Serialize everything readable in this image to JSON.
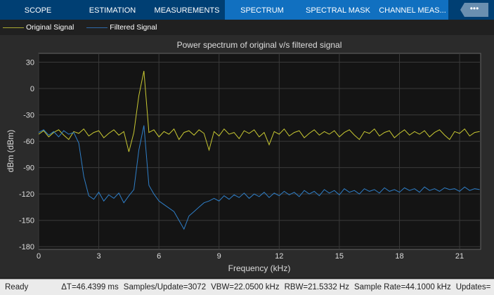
{
  "tabs": [
    {
      "label": "SCOPE",
      "active": false
    },
    {
      "label": "ESTIMATION",
      "active": false
    },
    {
      "label": "MEASUREMENTS",
      "active": false
    },
    {
      "label": "SPECTRUM",
      "active": true
    },
    {
      "label": "SPECTRAL MASK",
      "active": true
    },
    {
      "label": "CHANNEL MEAS..."
    }
  ],
  "more_label": "•••",
  "legend": [
    {
      "label": "Original Signal",
      "color": "#c8c832"
    },
    {
      "label": "Filtered Signal",
      "color": "#2f7fc8"
    }
  ],
  "status": {
    "state": "Ready",
    "delta_t": "ΔT=46.4399 ms",
    "samples": "Samples/Update=3072",
    "vbw": "VBW=22.0500 kHz",
    "rbw": "RBW=21.5332 Hz",
    "rate": "Sample Rate=44.1000 kHz",
    "updates": "Updates="
  },
  "chart_data": {
    "type": "line",
    "title": "Power spectrum of original v/s filtered signal",
    "xlabel": "Frequency (kHz)",
    "ylabel": "dBm (dBm)",
    "xlim": [
      0,
      22.05
    ],
    "ylim": [
      -183,
      40
    ],
    "xticks": [
      0,
      3,
      6,
      9,
      12,
      15,
      18,
      21
    ],
    "yticks": [
      30,
      0,
      -30,
      -60,
      -90,
      -120,
      -150,
      -180
    ],
    "grid": true,
    "x_step": 0.25,
    "series": [
      {
        "name": "Original Signal",
        "color": "#c8c832",
        "values": [
          -52,
          -48,
          -55,
          -50,
          -47,
          -53,
          -58,
          -49,
          -51,
          -46,
          -54,
          -50,
          -48,
          -56,
          -51,
          -47,
          -53,
          -49,
          -72,
          -50,
          -8,
          20,
          -50,
          -47,
          -55,
          -49,
          -52,
          -46,
          -58,
          -50,
          -48,
          -53,
          -47,
          -51,
          -70,
          -49,
          -54,
          -46,
          -52,
          -50,
          -57,
          -48,
          -51,
          -47,
          -55,
          -50,
          -64,
          -49,
          -52,
          -46,
          -54,
          -50,
          -48,
          -56,
          -51,
          -47,
          -53,
          -49,
          -52,
          -48,
          -55,
          -50,
          -47,
          -53,
          -58,
          -49,
          -51,
          -46,
          -54,
          -50,
          -48,
          -56,
          -51,
          -47,
          -53,
          -49,
          -52,
          -48,
          -55,
          -50,
          -47,
          -53,
          -58,
          -49,
          -51,
          -46,
          -54,
          -50,
          -49
        ]
      },
      {
        "name": "Filtered Signal",
        "color": "#2f7fc8",
        "values": [
          -50,
          -47,
          -53,
          -49,
          -55,
          -48,
          -52,
          -50,
          -62,
          -100,
          -122,
          -126,
          -118,
          -128,
          -121,
          -125,
          -119,
          -130,
          -122,
          -115,
          -70,
          -42,
          -110,
          -120,
          -128,
          -132,
          -136,
          -140,
          -150,
          -160,
          -145,
          -140,
          -135,
          -130,
          -128,
          -125,
          -128,
          -122,
          -126,
          -121,
          -124,
          -119,
          -125,
          -120,
          -123,
          -118,
          -124,
          -119,
          -122,
          -117,
          -121,
          -118,
          -123,
          -116,
          -120,
          -117,
          -122,
          -115,
          -119,
          -116,
          -121,
          -114,
          -118,
          -116,
          -120,
          -114,
          -117,
          -115,
          -119,
          -113,
          -117,
          -115,
          -118,
          -113,
          -116,
          -114,
          -118,
          -112,
          -116,
          -114,
          -117,
          -113,
          -115,
          -114,
          -117,
          -112,
          -116,
          -114,
          -115
        ]
      }
    ]
  }
}
